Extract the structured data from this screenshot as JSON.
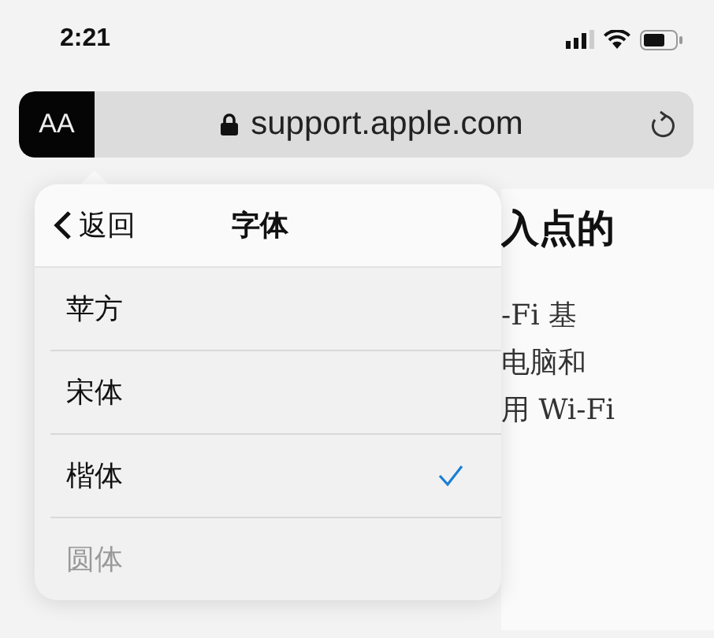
{
  "status_bar": {
    "time": "2:21"
  },
  "address_bar": {
    "text_size_button": "AA",
    "url": "support.apple.com"
  },
  "article": {
    "lines": [
      "入点的",
      "-Fi 基",
      "电脑和",
      "用 Wi-Fi"
    ]
  },
  "font_menu": {
    "back": "返回",
    "title": "字体",
    "items": [
      {
        "label": "苹方",
        "selected": false,
        "disabled": false
      },
      {
        "label": "宋体",
        "selected": false,
        "disabled": false
      },
      {
        "label": "楷体",
        "selected": true,
        "disabled": false
      },
      {
        "label": "圆体",
        "selected": false,
        "disabled": true
      }
    ]
  }
}
